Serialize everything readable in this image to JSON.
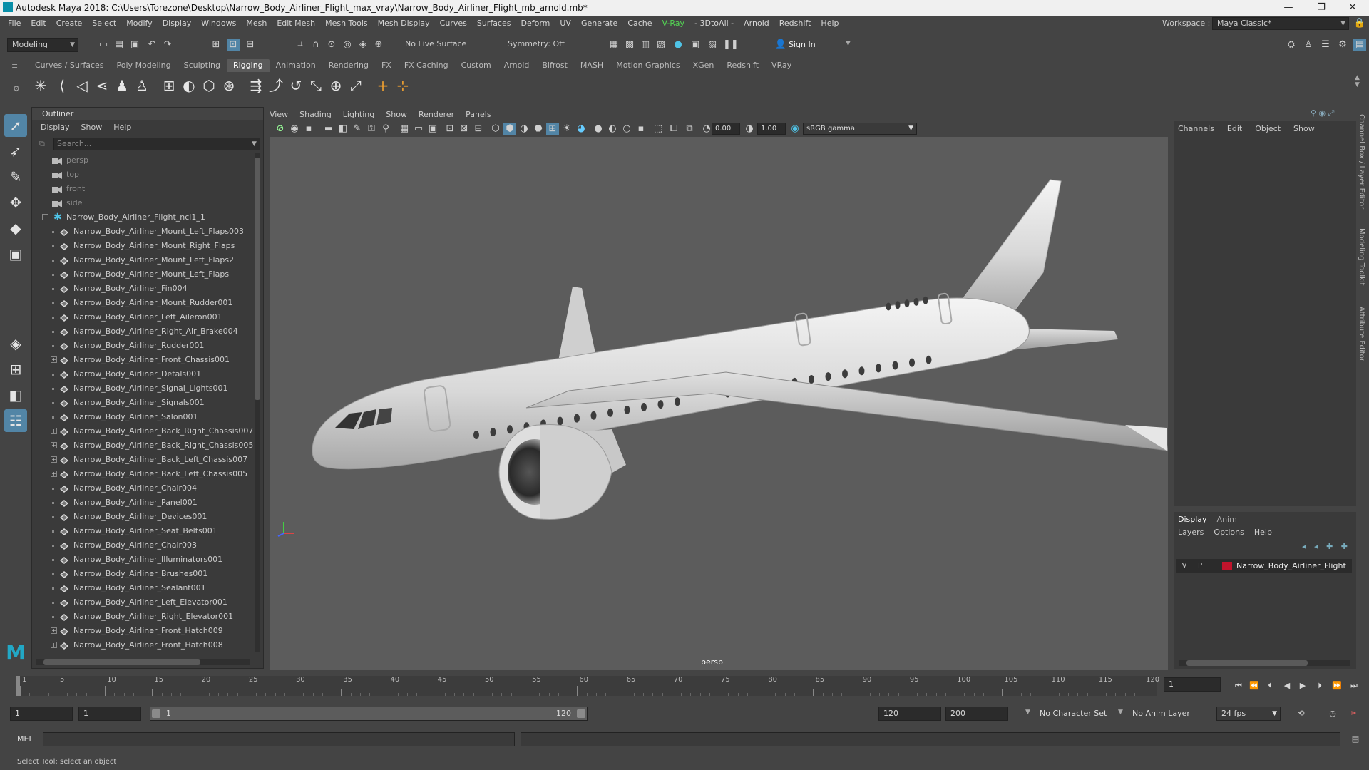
{
  "window": {
    "title": "Autodesk Maya 2018: C:\\Users\\Torezone\\Desktop\\Narrow_Body_Airliner_Flight_max_vray\\Narrow_Body_Airliner_Flight_mb_arnold.mb*",
    "minimize": "—",
    "maximize": "❐",
    "close": "✕"
  },
  "menubar": [
    "File",
    "Edit",
    "Create",
    "Select",
    "Modify",
    "Display",
    "Windows",
    "Mesh",
    "Edit Mesh",
    "Mesh Tools",
    "Mesh Display",
    "Curves",
    "Surfaces",
    "Deform",
    "UV",
    "Generate",
    "Cache",
    "V-Ray",
    "- 3DtoAll -",
    "Arnold",
    "Redshift",
    "Help"
  ],
  "workspace": {
    "label": "Workspace :",
    "value": "Maya Classic*"
  },
  "statusline": {
    "mode": "Modeling",
    "live_surface": "No Live Surface",
    "symmetry": "Symmetry: Off",
    "sign_in": "Sign In"
  },
  "shelf_tabs": [
    "Curves / Surfaces",
    "Poly Modeling",
    "Sculpting",
    "Rigging",
    "Animation",
    "Rendering",
    "FX",
    "FX Caching",
    "Custom",
    "Arnold",
    "Bifrost",
    "MASH",
    "Motion Graphics",
    "XGen",
    "Redshift",
    "VRay"
  ],
  "shelf_active": "Rigging",
  "outliner": {
    "title": "Outliner",
    "menu": [
      "Display",
      "Show",
      "Help"
    ],
    "search_placeholder": "Search...",
    "cameras": [
      "persp",
      "top",
      "front",
      "side"
    ],
    "group": "Narrow_Body_Airliner_Flight_ncl1_1",
    "items": [
      {
        "name": "Narrow_Body_Airliner_Mount_Left_Flaps003",
        "exp": false
      },
      {
        "name": "Narrow_Body_Airliner_Mount_Right_Flaps",
        "exp": false
      },
      {
        "name": "Narrow_Body_Airliner_Mount_Left_Flaps2",
        "exp": false
      },
      {
        "name": "Narrow_Body_Airliner_Mount_Left_Flaps",
        "exp": false
      },
      {
        "name": "Narrow_Body_Airliner_Fin004",
        "exp": false
      },
      {
        "name": "Narrow_Body_Airliner_Mount_Rudder001",
        "exp": false
      },
      {
        "name": "Narrow_Body_Airliner_Left_Aileron001",
        "exp": false
      },
      {
        "name": "Narrow_Body_Airliner_Right_Air_Brake004",
        "exp": false
      },
      {
        "name": "Narrow_Body_Airliner_Rudder001",
        "exp": false
      },
      {
        "name": "Narrow_Body_Airliner_Front_Chassis001",
        "exp": true
      },
      {
        "name": "Narrow_Body_Airliner_Detals001",
        "exp": false
      },
      {
        "name": "Narrow_Body_Airliner_Signal_Lights001",
        "exp": false
      },
      {
        "name": "Narrow_Body_Airliner_Signals001",
        "exp": false
      },
      {
        "name": "Narrow_Body_Airliner_Salon001",
        "exp": false
      },
      {
        "name": "Narrow_Body_Airliner_Back_Right_Chassis007",
        "exp": true
      },
      {
        "name": "Narrow_Body_Airliner_Back_Right_Chassis005",
        "exp": true
      },
      {
        "name": "Narrow_Body_Airliner_Back_Left_Chassis007",
        "exp": true
      },
      {
        "name": "Narrow_Body_Airliner_Back_Left_Chassis005",
        "exp": true
      },
      {
        "name": "Narrow_Body_Airliner_Chair004",
        "exp": false
      },
      {
        "name": "Narrow_Body_Airliner_Panel001",
        "exp": false
      },
      {
        "name": "Narrow_Body_Airliner_Devices001",
        "exp": false
      },
      {
        "name": "Narrow_Body_Airliner_Seat_Belts001",
        "exp": false
      },
      {
        "name": "Narrow_Body_Airliner_Chair003",
        "exp": false
      },
      {
        "name": "Narrow_Body_Airliner_Illuminators001",
        "exp": false
      },
      {
        "name": "Narrow_Body_Airliner_Brushes001",
        "exp": false
      },
      {
        "name": "Narrow_Body_Airliner_Sealant001",
        "exp": false
      },
      {
        "name": "Narrow_Body_Airliner_Left_Elevator001",
        "exp": false
      },
      {
        "name": "Narrow_Body_Airliner_Right_Elevator001",
        "exp": false
      },
      {
        "name": "Narrow_Body_Airliner_Front_Hatch009",
        "exp": true
      },
      {
        "name": "Narrow_Body_Airliner_Front_Hatch008",
        "exp": true
      }
    ]
  },
  "viewport": {
    "menu": [
      "View",
      "Shading",
      "Lighting",
      "Show",
      "Renderer",
      "Panels"
    ],
    "field_a": "0.00",
    "field_b": "1.00",
    "color_space": "sRGB gamma",
    "camera_label": "persp"
  },
  "channelbox": {
    "menu": [
      "Channels",
      "Edit",
      "Object",
      "Show"
    ],
    "side_tabs": [
      "Channel Box / Layer Editor",
      "Modeling Toolkit",
      "Attribute Editor"
    ]
  },
  "layer_editor": {
    "tabs": [
      "Display",
      "Anim"
    ],
    "menu": [
      "Layers",
      "Options",
      "Help"
    ],
    "layer": {
      "v": "V",
      "p": "P",
      "name": "Narrow_Body_Airliner_Flight",
      "color": "#c0142c"
    }
  },
  "timeline": {
    "ticks": [
      1,
      5,
      10,
      15,
      20,
      25,
      30,
      35,
      40,
      45,
      50,
      55,
      60,
      65,
      70,
      75,
      80,
      85,
      90,
      95,
      100,
      105,
      110,
      115,
      120
    ],
    "current_frame": "1",
    "range_start": "1",
    "playback_start": "1",
    "range_slider_start": "1",
    "range_slider_end": "120",
    "playback_end": "120",
    "range_end": "200",
    "character_set": "No Character Set",
    "anim_layer": "No Anim Layer",
    "fps": "24 fps"
  },
  "cmdline": {
    "label": "MEL"
  },
  "helpline": "Select Tool: select an object"
}
